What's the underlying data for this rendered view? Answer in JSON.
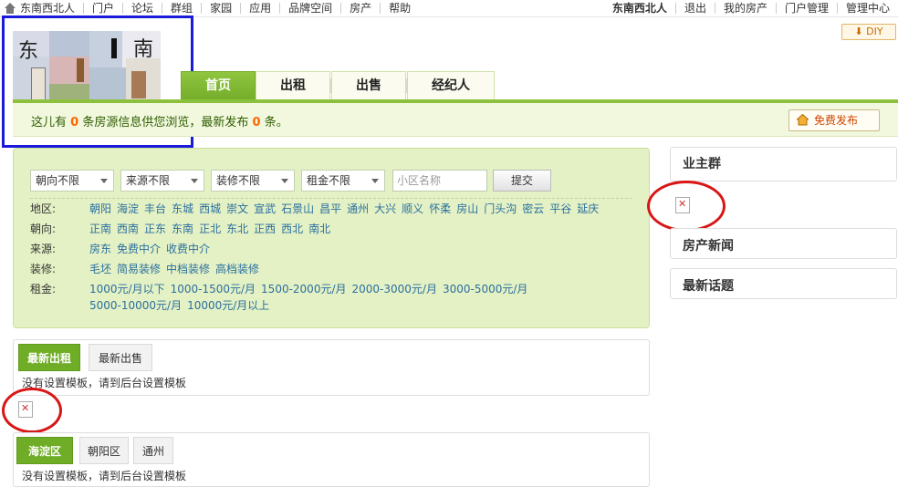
{
  "topbar": {
    "site_name": "东南西北人",
    "nav": [
      "门户",
      "论坛",
      "群组",
      "家园",
      "应用",
      "品牌空间",
      "房产",
      "帮助"
    ],
    "user": "东南西北人",
    "logout": "退出",
    "my_house": "我的房产",
    "portal_admin": "门户管理",
    "admin_center": "管理中心"
  },
  "diy_label": "DIY",
  "logo": {
    "left_char": "东",
    "right_char": "南"
  },
  "tabs": [
    "首页",
    "出租",
    "出售",
    "经纪人"
  ],
  "notice": {
    "prefix": "这儿有",
    "total": "0",
    "mid": "条房源信息供您浏览，最新发布",
    "latest": "0",
    "suffix": "条。"
  },
  "post_button": "免费发布",
  "filter": {
    "selects": [
      "朝向不限",
      "来源不限",
      "装修不限",
      "租金不限"
    ],
    "community_placeholder": "小区名称",
    "submit": "提交",
    "rows": [
      {
        "label": "地区:",
        "values": [
          "朝阳",
          "海淀",
          "丰台",
          "东城",
          "西城",
          "崇文",
          "宣武",
          "石景山",
          "昌平",
          "通州",
          "大兴",
          "顺义",
          "怀柔",
          "房山",
          "门头沟",
          "密云",
          "平谷",
          "延庆"
        ]
      },
      {
        "label": "朝向:",
        "values": [
          "正南",
          "西南",
          "正东",
          "东南",
          "正北",
          "东北",
          "正西",
          "西北",
          "南北"
        ]
      },
      {
        "label": "来源:",
        "values": [
          "房东",
          "免费中介",
          "收费中介"
        ]
      },
      {
        "label": "装修:",
        "values": [
          "毛坯",
          "简易装修",
          "中档装修",
          "高档装修"
        ]
      },
      {
        "label": "租金:",
        "values": [
          "1000元/月以下",
          "1000-1500元/月",
          "1500-2000元/月",
          "2000-3000元/月",
          "3000-5000元/月",
          "5000-10000元/月",
          "10000元/月以上"
        ]
      }
    ]
  },
  "right": {
    "owner_group": "业主群",
    "news": "房产新闻",
    "topics": "最新话题"
  },
  "panel1": {
    "tabs": [
      "最新出租",
      "最新出售"
    ],
    "note": "没有设置模板，请到后台设置模板"
  },
  "panel2": {
    "tabs": [
      "海淀区",
      "朝阳区",
      "通州"
    ],
    "note": "没有设置模板，请到后台设置模板"
  }
}
